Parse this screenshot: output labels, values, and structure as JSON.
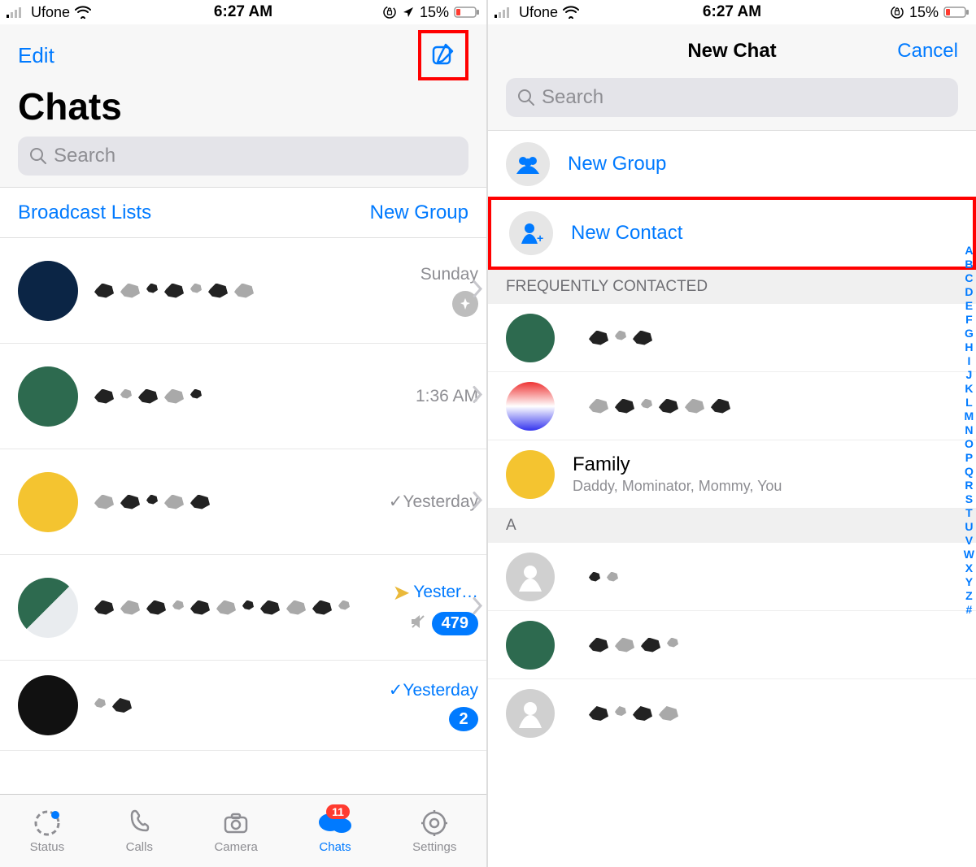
{
  "status": {
    "carrier": "Ufone",
    "time": "6:27 AM",
    "battery_pct": "15%"
  },
  "left": {
    "edit": "Edit",
    "title": "Chats",
    "search_placeholder": "Search",
    "broadcast_lists": "Broadcast Lists",
    "new_group": "New Group",
    "chats": [
      {
        "time": "Sunday",
        "pinned": true
      },
      {
        "time": "1:36 AM"
      },
      {
        "time": "Yesterday"
      },
      {
        "time": "Yester…",
        "unread": "479",
        "muted": true,
        "time_color": "blue"
      },
      {
        "time": "Yesterday",
        "unread": "2",
        "time_color": "blue"
      }
    ],
    "tabs": {
      "status": "Status",
      "calls": "Calls",
      "camera": "Camera",
      "chats": "Chats",
      "settings": "Settings",
      "chats_badge": "11"
    }
  },
  "right": {
    "title": "New Chat",
    "cancel": "Cancel",
    "search_placeholder": "Search",
    "new_group": "New Group",
    "new_contact": "New Contact",
    "section_freq": "FREQUENTLY CONTACTED",
    "family": {
      "name": "Family",
      "members": "Daddy, Mominator, Mommy, You"
    },
    "section_a": "A",
    "alpha_index": [
      "A",
      "B",
      "C",
      "D",
      "E",
      "F",
      "G",
      "H",
      "I",
      "J",
      "K",
      "L",
      "M",
      "N",
      "O",
      "P",
      "Q",
      "R",
      "S",
      "T",
      "U",
      "V",
      "W",
      "X",
      "Y",
      "Z",
      "#"
    ]
  }
}
